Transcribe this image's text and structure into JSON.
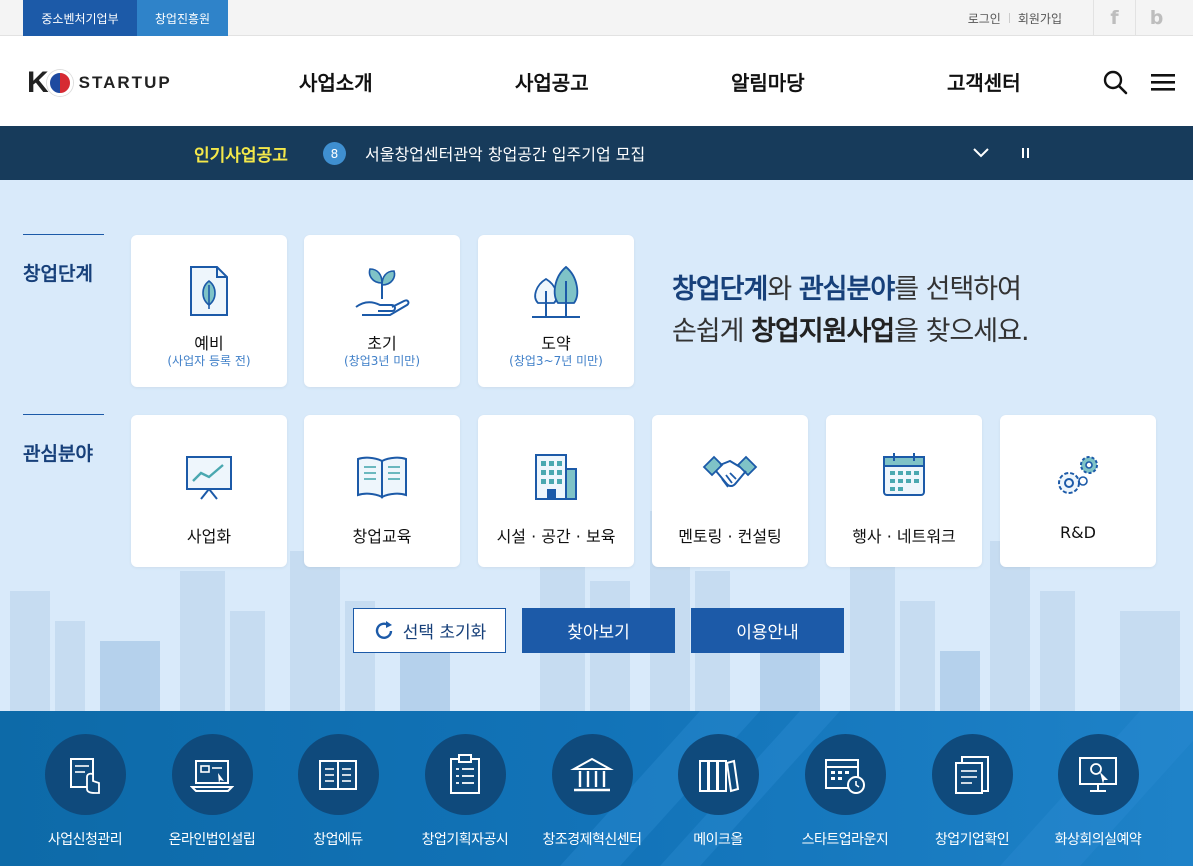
{
  "util": {
    "ministry": "중소벤처기업부",
    "agency": "창업진흥원",
    "login": "로그인",
    "signup": "회원가입",
    "facebook": "f",
    "blog": "b"
  },
  "header": {
    "logo_k": "K",
    "logo_word": "STARTUP",
    "menu": [
      "사업소개",
      "사업공고",
      "알림마당",
      "고객센터"
    ],
    "icons": [
      "search-icon",
      "hamburger-menu-icon"
    ]
  },
  "ticker": {
    "label": "인기사업공고",
    "number": "8",
    "text": "서울창업센터관악 창업공간 입주기업 모집"
  },
  "stage": {
    "title": "창업단계",
    "cards": [
      {
        "label": "예비",
        "sub": "(사업자 등록 전)",
        "icon": "document-leaf-icon"
      },
      {
        "label": "초기",
        "sub": "(창업3년 미만)",
        "icon": "sprout-hand-icon"
      },
      {
        "label": "도약",
        "sub": "(창업3~7년 미만)",
        "icon": "trees-icon"
      }
    ]
  },
  "headline": {
    "l1_a": "창업단계",
    "l1_b": "와 ",
    "l1_c": "관심분야",
    "l1_d": "를 선택하여",
    "l2_a": "손쉽게 ",
    "l2_b": "창업지원사업",
    "l2_c": "을 찾으세요."
  },
  "field": {
    "title": "관심분야",
    "cards": [
      {
        "label": "사업화",
        "icon": "chart-monitor-icon"
      },
      {
        "label": "창업교육",
        "icon": "open-book-icon"
      },
      {
        "label": "시설 · 공간 · 보육",
        "icon": "building-icon"
      },
      {
        "label": "멘토링 · 컨설팅",
        "icon": "handshake-icon"
      },
      {
        "label": "행사 · 네트워크",
        "icon": "calendar-icon"
      },
      {
        "label": "R&D",
        "icon": "gears-icon"
      }
    ]
  },
  "buttons": {
    "reset": "선택 초기화",
    "search": "찾아보기",
    "guide": "이용안내"
  },
  "quick": [
    {
      "label": "사업신청관리",
      "icon": "application-hand-icon"
    },
    {
      "label": "온라인법인설립",
      "icon": "laptop-form-icon"
    },
    {
      "label": "창업에듀",
      "icon": "book-icon"
    },
    {
      "label": "창업기획자공시",
      "icon": "clipboard-list-icon"
    },
    {
      "label": "창조경제혁신센터",
      "icon": "institution-icon"
    },
    {
      "label": "메이크올",
      "icon": "books-shelf-icon"
    },
    {
      "label": "스타트업라운지",
      "icon": "calendar-clock-icon"
    },
    {
      "label": "창업기업확인",
      "icon": "certificate-icon"
    },
    {
      "label": "화상회의실예약",
      "icon": "monitor-cursor-icon"
    }
  ],
  "colors": {
    "primary": "#1c5aa8",
    "ticker_bg": "#173b5b",
    "ticker_label": "#f4e84a",
    "main_bg": "#d9eafa",
    "quick_bg": "#1273b8"
  }
}
